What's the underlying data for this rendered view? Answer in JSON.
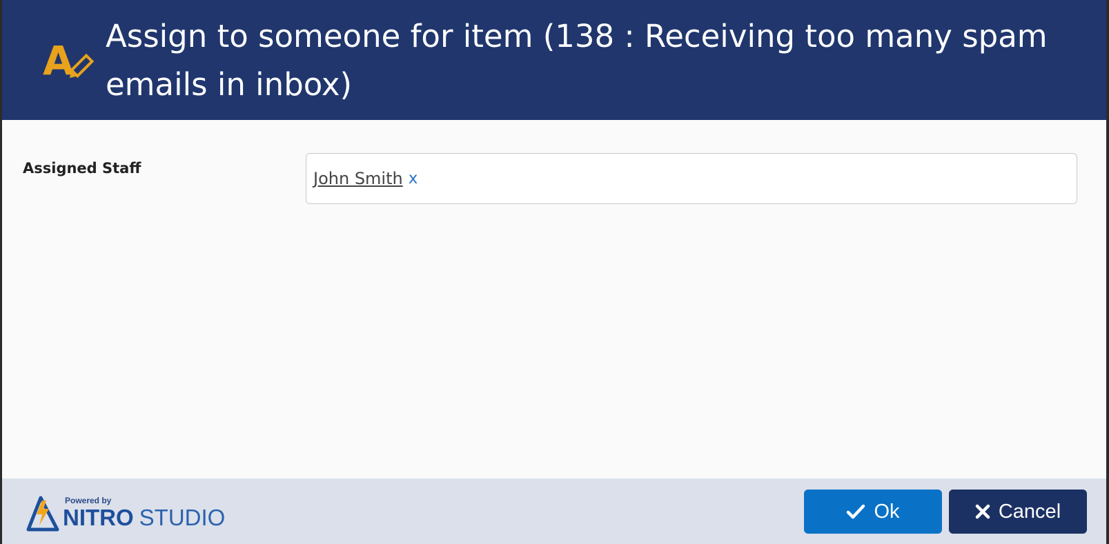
{
  "dialog": {
    "title": "Assign to someone for item (138 : Receiving too many spam emails in inbox)",
    "colors": {
      "header": "#20366d",
      "icon_accent": "#e8a21c",
      "footer": "#dbe0eb",
      "ok_button": "#0a72c6",
      "cancel_button": "#1c3163"
    }
  },
  "form": {
    "assigned_staff_label": "Assigned Staff",
    "assigned_staff_token": "John Smith",
    "token_remove_label": "x"
  },
  "footer": {
    "powered_by": "Powered by",
    "brand_bold": "NITRO",
    "brand_light": "STUDIO",
    "ok_label": "Ok",
    "cancel_label": "Cancel"
  },
  "icons": {
    "header": "rename-icon",
    "ok": "checkmark-icon",
    "cancel": "close-icon",
    "brand": "nitro-logo-icon"
  }
}
